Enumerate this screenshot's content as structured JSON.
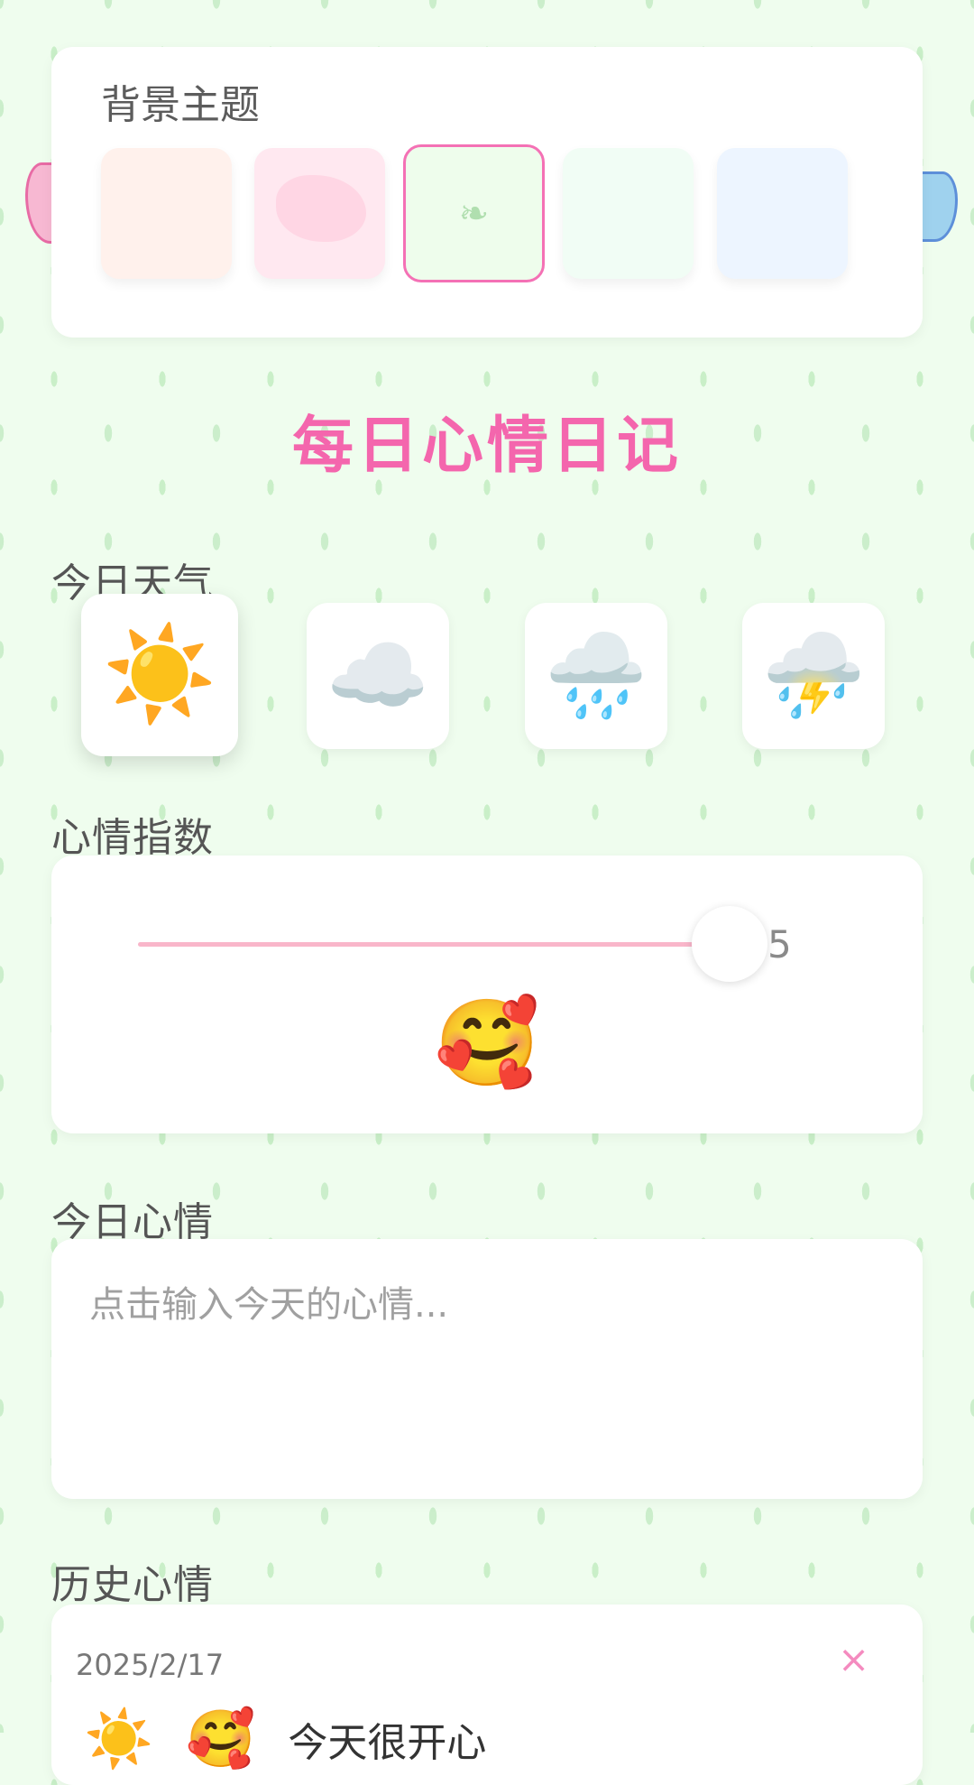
{
  "theme_picker": {
    "title": "背景主题",
    "swatches": [
      {
        "name": "peach",
        "color": "#fff1ec",
        "selected": false
      },
      {
        "name": "pink-waves",
        "color": "#ffe8f0",
        "selected": false
      },
      {
        "name": "green-leaves",
        "color": "#eefdec",
        "selected": true
      },
      {
        "name": "mint",
        "color": "#f1fdf5",
        "selected": false
      },
      {
        "name": "sky-blue",
        "color": "#edf5ff",
        "selected": false
      }
    ]
  },
  "header": {
    "title": "每日心情日记"
  },
  "weather": {
    "label": "今日天气",
    "options": [
      {
        "icon": "sun-icon",
        "glyph": "☀️",
        "selected": true
      },
      {
        "icon": "cloud-icon",
        "glyph": "☁️",
        "selected": false
      },
      {
        "icon": "rain-icon",
        "glyph": "🌧️",
        "selected": false
      },
      {
        "icon": "thunderstorm-icon",
        "glyph": "⛈️",
        "selected": false
      }
    ]
  },
  "mood": {
    "label": "心情指数",
    "value": "5",
    "max": 5,
    "emoji": "🥰"
  },
  "diary": {
    "label": "今日心情",
    "placeholder": "点击输入今天的心情...",
    "value": ""
  },
  "history": {
    "label": "历史心情",
    "entries": [
      {
        "date": "2025/2/17",
        "delete_label": "×",
        "weather_glyph": "☀️",
        "mood_glyph": "🥰",
        "text": "今天很开心"
      }
    ]
  },
  "colors": {
    "accent": "#f466ad",
    "background": "#effdee",
    "slider_track": "#f9b6ca"
  }
}
